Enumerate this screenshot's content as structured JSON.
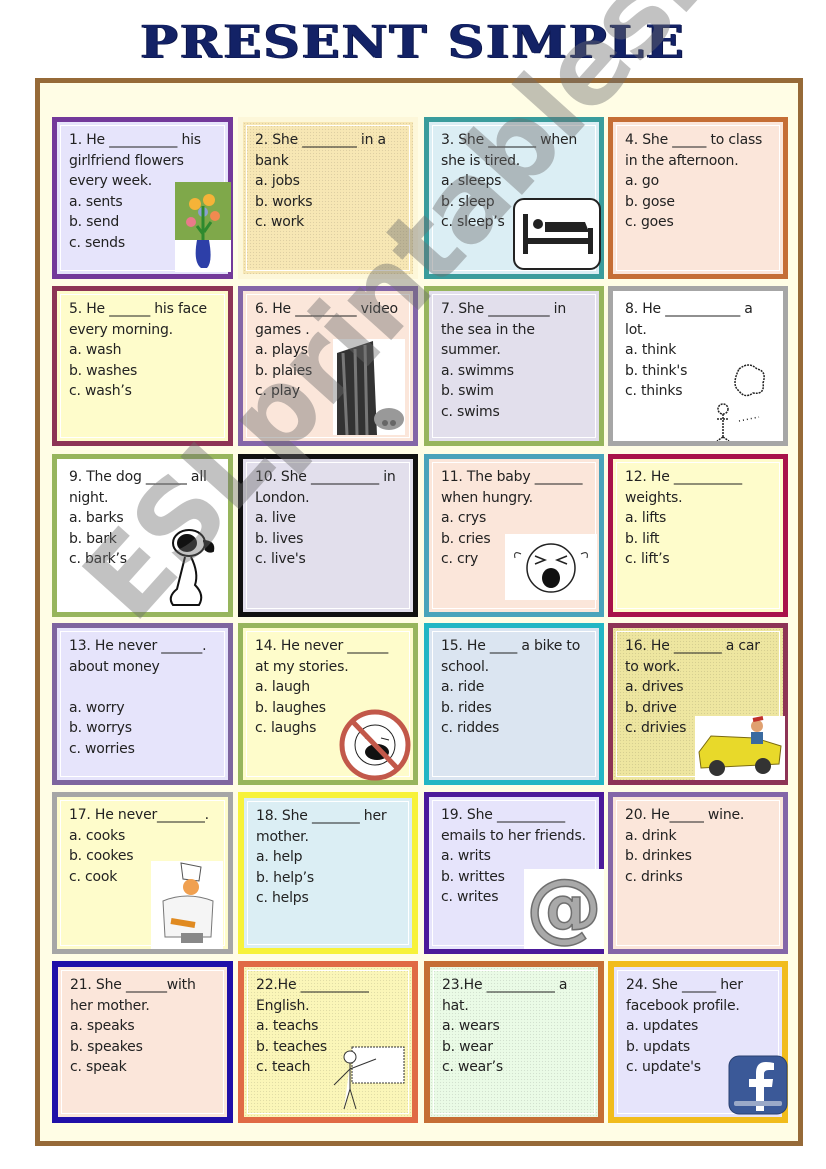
{
  "title": "PRESENT SIMPLE",
  "watermark": "ESLprintables.com",
  "cards": [
    {
      "n": "1",
      "q": "1. He __________ his girlfriend flowers every week.",
      "opts": [
        "a. sents",
        "b. send",
        "c. sends"
      ],
      "picture": "flower-vase",
      "border": "#73399a",
      "bg": "#e6e4fb"
    },
    {
      "n": "2",
      "q": "2. She ________ in a bank",
      "opts": [
        "a. jobs",
        "b. works",
        "c. work"
      ],
      "picture": "",
      "border": "#fdf7d9",
      "bg": "#f7e7b4"
    },
    {
      "n": "3",
      "q": "3. She _______ when she is tired.",
      "opts": [
        "a. sleeps",
        "b. sleep",
        "c. sleep’s"
      ],
      "picture": "bed-sign",
      "border": "#3a9c9c",
      "bg": "#dbeef4"
    },
    {
      "n": "4",
      "q": "4. She _____  to class in the  afternoon.",
      "opts": [
        "a. go",
        "b. gose",
        "c. goes"
      ],
      "picture": "",
      "border": "#c56e35",
      "bg": "#fbe6da"
    },
    {
      "n": "5",
      "q": "5. He ______ his face every morning.",
      "opts": [
        "a. wash",
        "b. washes",
        "c. wash’s"
      ],
      "picture": "",
      "border": "#8d3455",
      "bg": "#fefccb"
    },
    {
      "n": "6",
      "q": "6. He _________ video games .",
      "opts": [
        "a. plays",
        "b. plaies",
        "c. play"
      ],
      "picture": "game-console",
      "border": "#8466a8",
      "bg": "#fbe6da"
    },
    {
      "n": "7",
      "q": "7. She _________ in the sea in the summer.",
      "opts": [
        "a. swimms",
        "b. swim",
        "c. swims"
      ],
      "picture": "",
      "border": "#97b55d",
      "bg": "#e2dfec"
    },
    {
      "n": "8",
      "q": "8. He ___________ a lot.",
      "opts": [
        "a. think",
        "b. think's",
        "c. thinks"
      ],
      "picture": "thinking-man",
      "border": "#a6a6a6",
      "bg": "#ffffff"
    },
    {
      "n": "9",
      "q": "9. The dog ______ all night.",
      "opts": [
        "a. barks",
        "b. bark",
        "c. bark’s"
      ],
      "picture": "barking-dog",
      "border": "#97b55d",
      "bg": "#ffffff"
    },
    {
      "n": "10",
      "q": "10. She __________ in London.",
      "opts": [
        "a. live",
        "b. lives",
        "c. live's"
      ],
      "picture": "",
      "border": "#111111",
      "bg": "#e2dfec"
    },
    {
      "n": "11",
      "q": "11. The baby _______ when hungry.",
      "opts": [
        "a. crys",
        "b. cries",
        "c. cry"
      ],
      "picture": "crying-face",
      "border": "#4aa3bb",
      "bg": "#fbe6da"
    },
    {
      "n": "12",
      "q": "12. He __________ weights.",
      "opts": [
        "a. lifts",
        "b. lift",
        "c. lift’s"
      ],
      "picture": "",
      "border": "#a8124a",
      "bg": "#fefccb"
    },
    {
      "n": "13",
      "q": "13. He never ______. about money",
      "opts": [
        "",
        "a. worry",
        "b. worrys",
        "c. worries"
      ],
      "picture": "",
      "border": "#7e659f",
      "bg": "#e6e4fb"
    },
    {
      "n": "14",
      "q": "14. He  never ______ at my stories.",
      "opts": [
        "a. laugh",
        "b. laughes",
        "c. laughs"
      ],
      "picture": "no-laughing",
      "border": "#97b55d",
      "bg": "#fefccb"
    },
    {
      "n": "15",
      "q": "15. He ____ a bike to school.",
      "opts": [
        "a. ride",
        "b. rides",
        "c. riddes"
      ],
      "picture": "",
      "border": "#22b6c4",
      "bg": "#dbe5f1"
    },
    {
      "n": "16",
      "q": "16. He _______ a car to work.",
      "opts": [
        "a. drives",
        "b. drive",
        "c. drivies"
      ],
      "picture": "yellow-car",
      "border": "#8d3455",
      "bg": "#eee6a0"
    },
    {
      "n": "17",
      "q": "17. He never_______.",
      "opts": [
        "a. cooks",
        "b. cookes",
        "c. cook"
      ],
      "picture": "chef",
      "border": "#a6a6a6",
      "bg": "#fefccb"
    },
    {
      "n": "18",
      "q": "18. She _______ her mother.",
      "opts": [
        "a. help",
        "b. help’s",
        "c. helps"
      ],
      "picture": "",
      "border": "#f7f23a",
      "bg": "#dbeef4"
    },
    {
      "n": "19",
      "q": "19. She __________ emails to her friends.",
      "opts": [
        "a. writs",
        "b. writtes",
        "c. writes"
      ],
      "picture": "at-sign",
      "border": "#4b1a9a",
      "bg": "#e6e4fb"
    },
    {
      "n": "20",
      "q": "20. He_____ wine.",
      "opts": [
        "a. drink",
        "b. drinkes",
        "c. drinks"
      ],
      "picture": "",
      "border": "#8466a8",
      "bg": "#fbe6da"
    },
    {
      "n": "21",
      "q": "21. She ______with her mother.",
      "opts": [
        "a. speaks",
        "b. speakes",
        "c. speak"
      ],
      "picture": "",
      "border": "#2010a8",
      "bg": "#fbe6da"
    },
    {
      "n": "22",
      "q": "22.He __________ English.",
      "opts": [
        "a. teachs",
        "b. teaches",
        "c. teach"
      ],
      "picture": "teacher",
      "border": "#e06a45",
      "bg": "#fbf6b8"
    },
    {
      "n": "23",
      "q": "23.He __________ a hat.",
      "opts": [
        "a. wears",
        "b. wear",
        "c. wear’s"
      ],
      "picture": "",
      "border": "#c56e35",
      "bg": "#eafbe6"
    },
    {
      "n": "24",
      "q": "24. She _____ her facebook profile.",
      "opts": [
        "a. updates",
        "b. updats",
        "c. update's"
      ],
      "picture": "facebook-logo",
      "border": "#f1bc1c",
      "bg": "#e6e4fb"
    }
  ]
}
